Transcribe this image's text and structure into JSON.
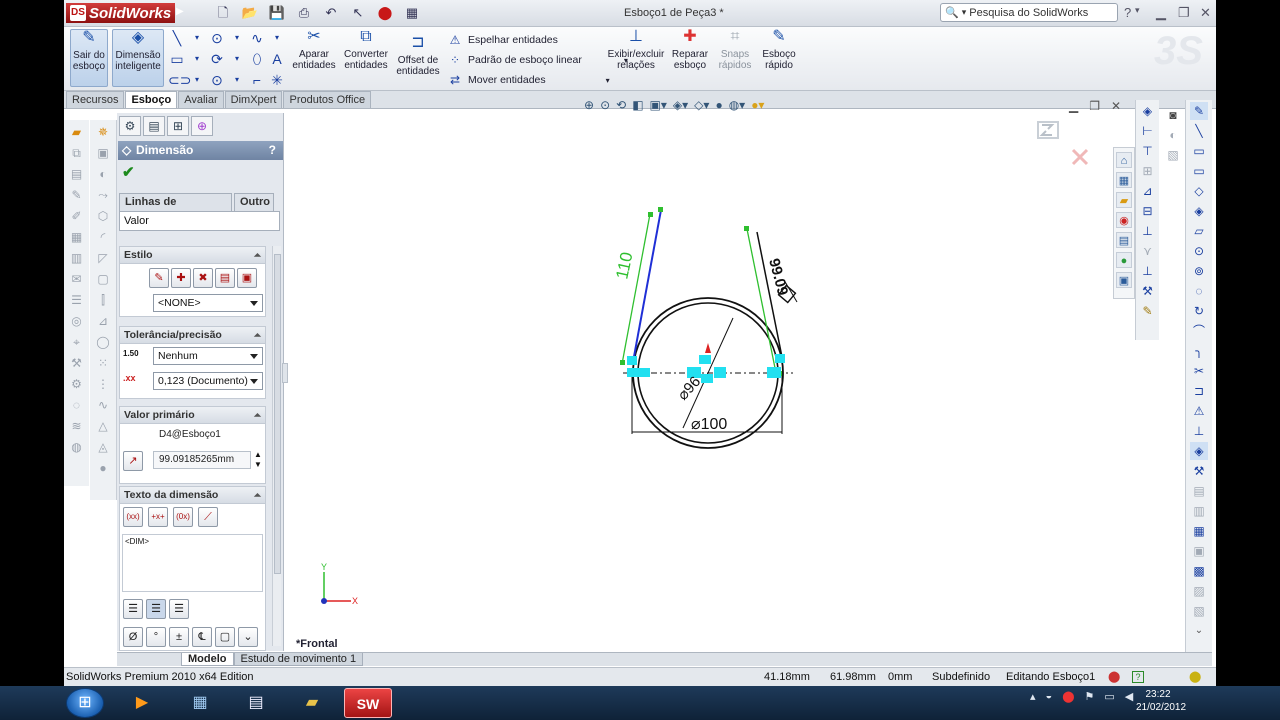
{
  "app": {
    "logo_text": "SolidWorks",
    "document_title": "Esboço1 de Peça3 *",
    "search_placeholder": "Pesquisa do SolidWorks",
    "help_icon": "?"
  },
  "command_manager": {
    "exit_sketch": "Sair do esboço",
    "smart_dimension": "Dimensão inteligente",
    "trim": "Aparar entidades",
    "convert": "Converter entidades",
    "offset": "Offset de entidades",
    "mirror": "Espelhar entidades",
    "linear_pattern": "Padrão de esboço linear",
    "move": "Mover entidades",
    "relations": "Exibir/excluir relações",
    "repair": "Reparar esboço",
    "snaps": "Snaps rápidos",
    "quick_sketch": "Esboço rápido"
  },
  "tabs": [
    "Recursos",
    "Esboço",
    "Avaliar",
    "DimXpert",
    "Produtos Office"
  ],
  "active_tab": "Esboço",
  "property_manager": {
    "title": "Dimensão",
    "help": "?",
    "subtabs": [
      "Linhas de chamada",
      "Outro"
    ],
    "value_tab": "Valor",
    "style": {
      "header": "Estilo",
      "selected": "<NONE>"
    },
    "tolerance": {
      "header": "Tolerância/precisão",
      "tolerance_type": "Nenhum",
      "precision": "0,123 (Documento)",
      "tol_icon_text": "1.50"
    },
    "primary_value": {
      "header": "Valor primário",
      "name": "D4@Esboço1",
      "value": "99.09185265mm"
    },
    "dim_text": {
      "header": "Texto da dimensão",
      "text": "<DIM>"
    }
  },
  "graphics": {
    "view_name": "*Frontal",
    "dim_line_length": "110",
    "dim_angled": "99.09",
    "dim_inner_diameter": "⌀96",
    "dim_outer_diameter": "⌀100",
    "triad_x": "X",
    "triad_y": "Y",
    "ds_watermark": "3S"
  },
  "bottom_tabs": [
    "Modelo",
    "Estudo de movimento 1"
  ],
  "status": {
    "edition": "SolidWorks Premium 2010 x64 Edition",
    "x": "41.18mm",
    "y": "61.98mm",
    "z": "0mm",
    "state": "Subdefinido",
    "editing": "Editando Esboço1"
  },
  "taskbar": {
    "time": "23:22",
    "date": "21/02/2012",
    "sw_label": "SW"
  },
  "colors": {
    "accent": "#1a4fa8",
    "sketch_blue": "#1f2fd6",
    "sketch_green": "#2fbf2f",
    "highlight_cyan": "#22e0f0"
  }
}
